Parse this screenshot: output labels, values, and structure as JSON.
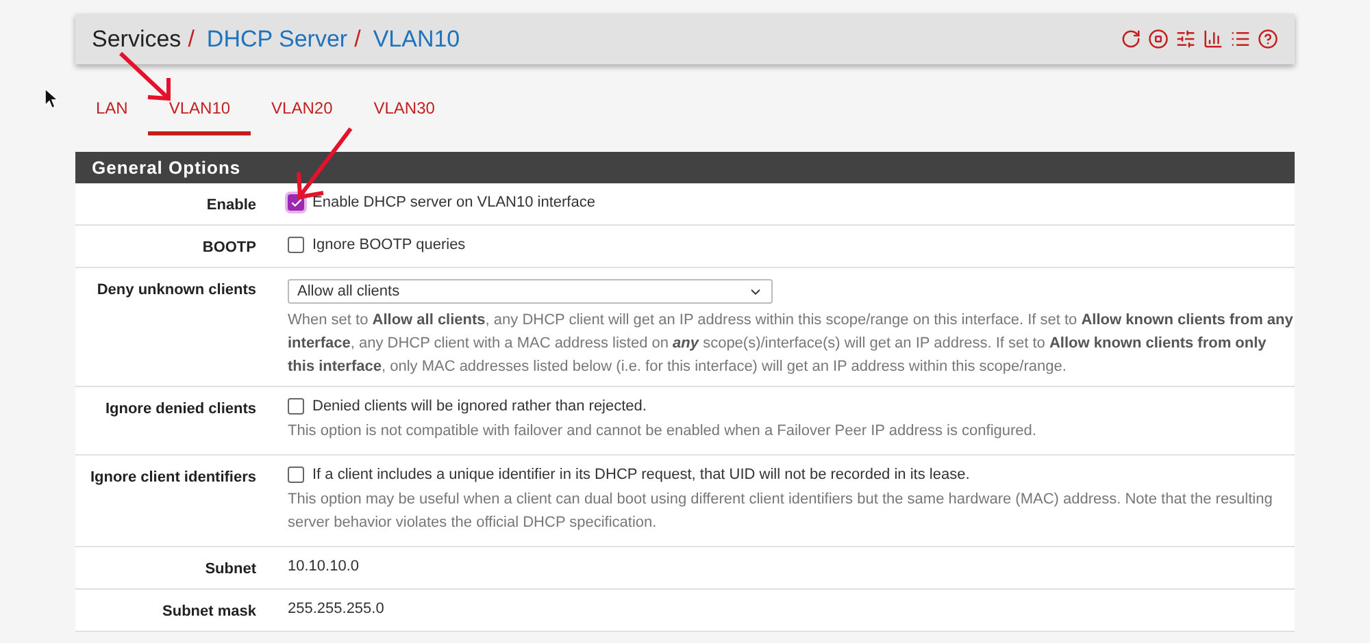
{
  "breadcrumb": [
    {
      "kind": "text",
      "label": "Services"
    },
    {
      "kind": "separator",
      "label": "/"
    },
    {
      "kind": "link",
      "label": "DHCP Server"
    },
    {
      "kind": "separator",
      "label": "/"
    },
    {
      "kind": "link",
      "label": "VLAN10"
    }
  ],
  "tabs": [
    {
      "label": "LAN",
      "selected": false
    },
    {
      "label": "VLAN10",
      "selected": true
    },
    {
      "label": "VLAN20",
      "selected": false
    },
    {
      "label": "VLAN30",
      "selected": false
    }
  ],
  "section": {
    "title": "General Options"
  },
  "rows": [
    {
      "kind": "checkbox",
      "label": "Enable",
      "text": "Enable DHCP server on VLAN10 interface",
      "checked": true
    },
    {
      "kind": "checkbox",
      "label": "BOOTP",
      "text": "Ignore BOOTP queries",
      "checked": false
    },
    {
      "kind": "select",
      "label": "Deny unknown clients",
      "value": "Allow all clients",
      "help": "When set to **Allow all clients**, any DHCP client will get an IP address within this scope/range on this interface. If set to **Allow known clients from any interface**, any DHCP client with a MAC address listed on *any* scope(s)/interface(s) will get an IP address. If set to **Allow known clients from only this interface**, only MAC addresses listed below (i.e. for this interface) will get an IP address within this scope/range."
    },
    {
      "kind": "checkbox",
      "label": "Ignore denied clients",
      "text": "Denied clients will be ignored rather than rejected.",
      "checked": false,
      "help": "This option is not compatible with failover and cannot be enabled when a Failover Peer IP address is configured."
    },
    {
      "kind": "checkbox",
      "label": "Ignore client identifiers",
      "text": "If a client includes a unique identifier in its DHCP request, that UID will not be recorded in its lease.",
      "checked": false,
      "help": "This option may be useful when a client can dual boot using different client identifiers but the same hardware (MAC) address. Note that the resulting server behavior violates the official DHCP specification."
    },
    {
      "kind": "static",
      "label": "Subnet",
      "value": "10.10.10.0"
    },
    {
      "kind": "static",
      "label": "Subnet mask",
      "value": "255.255.255.0"
    }
  ]
}
